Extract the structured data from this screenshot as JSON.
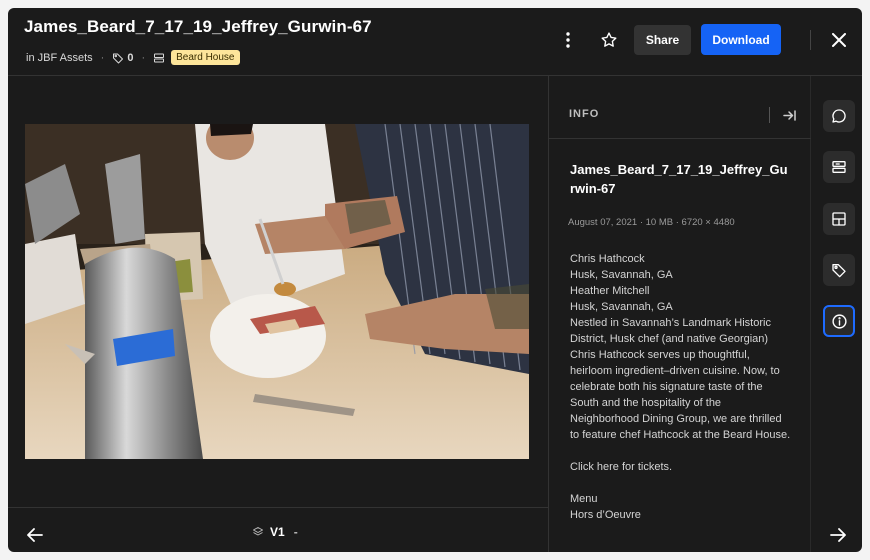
{
  "header": {
    "title": "James_Beard_7_17_19_Jeffrey_Gurwin-67",
    "location_prefix": "in",
    "location": "JBF Assets",
    "tag_count": "0",
    "board_badge": "Beard House",
    "share_label": "Share",
    "download_label": "Download"
  },
  "viewer": {
    "version_label": "V1",
    "version_dash": "-"
  },
  "info": {
    "panel_title": "INFO",
    "file_name": "James_Beard_7_17_19_Jeffrey_Gurwin-67",
    "file_meta": "August 07, 2021 · 10 MB · 6720 × 4480",
    "description_lines": [
      "Chris Hathcock",
      "Husk, Savannah, GA",
      "Heather Mitchell",
      "Husk, Savannah, GA",
      "Nestled in Savannah’s Landmark Historic District, Husk chef (and native Georgian) Chris Hathcock serves up thoughtful, heirloom ingredient–driven cuisine. Now, to celebrate both his signature taste of the South and the hospitality of the Neighborhood Dining Group, we are thrilled to feature chef Hathcock at the Beard House."
    ],
    "tickets_line": "Click here for tickets.",
    "menu_heading": "Menu",
    "menu_first": "Hors d’Oeuvre"
  },
  "colors": {
    "background": "#1b1b1b",
    "accent": "#1563f5",
    "badge": "#fde59a"
  },
  "icons": [
    "more-vertical-icon",
    "star-icon",
    "close-icon",
    "tag-icon",
    "board-icon",
    "collapse-panel-icon",
    "arrow-left-icon",
    "arrow-right-icon",
    "layers-icon",
    "comment-icon",
    "boards-icon",
    "layout-icon",
    "tags-icon",
    "info-icon"
  ]
}
